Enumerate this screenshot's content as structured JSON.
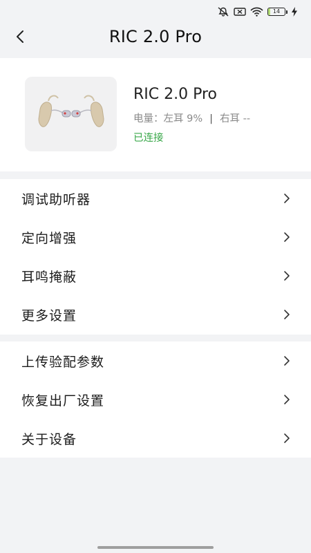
{
  "status_bar": {
    "battery_level": "14",
    "battery_fill_fraction": 0.14,
    "icons": [
      "mute-icon",
      "sim-off-icon",
      "wifi-icon",
      "battery-icon",
      "charging-icon"
    ]
  },
  "header": {
    "title": "RIC 2.0 Pro",
    "back_icon": "chevron-left-icon"
  },
  "device": {
    "name": "RIC 2.0 Pro",
    "battery_label": "电量：",
    "left_ear": "左耳 9%",
    "separator": "|",
    "right_ear": "右耳 --",
    "status": "已连接",
    "status_color": "#3aa84a"
  },
  "menu_group_1": [
    {
      "label": "调试助听器"
    },
    {
      "label": "定向增强"
    },
    {
      "label": "耳鸣掩蔽"
    },
    {
      "label": "更多设置"
    }
  ],
  "menu_group_2": [
    {
      "label": "上传验配参数"
    },
    {
      "label": "恢复出厂设置"
    },
    {
      "label": "关于设备"
    }
  ],
  "colors": {
    "background": "#f2f3f5",
    "card": "#ffffff",
    "connected_green": "#3aa84a"
  }
}
